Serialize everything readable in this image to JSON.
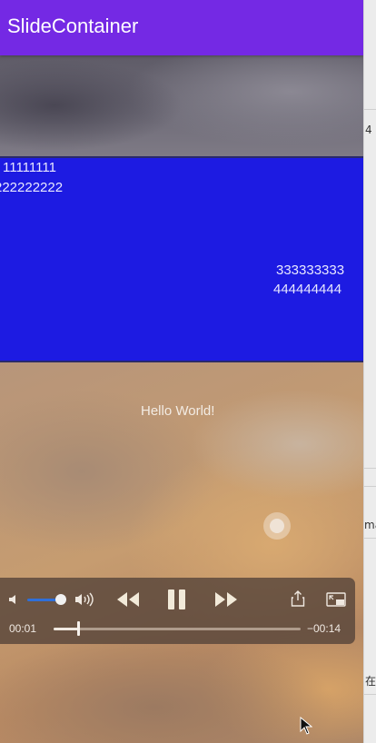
{
  "app_bar": {
    "title": "SlideContainer",
    "color": "#7429e4"
  },
  "blue_panel": {
    "color": "#1d1be2",
    "line1": "11111111",
    "line2": "222222222",
    "line3": "333333333",
    "line4": "444444444"
  },
  "video": {
    "overlay_text": "Hello World!",
    "controls": {
      "volume_level": 0.8,
      "current_time": "00:01",
      "remaining_time": "−00:14",
      "progress": 0.1,
      "icons": [
        "volume-low-icon",
        "volume-high-icon",
        "rewind-icon",
        "pause-icon",
        "fast-forward-icon",
        "share-icon",
        "picture-in-picture-icon"
      ]
    }
  },
  "background_window": {
    "fragment_top": "4",
    "fragment_mid": "ma",
    "fragment_bottom": "在"
  }
}
